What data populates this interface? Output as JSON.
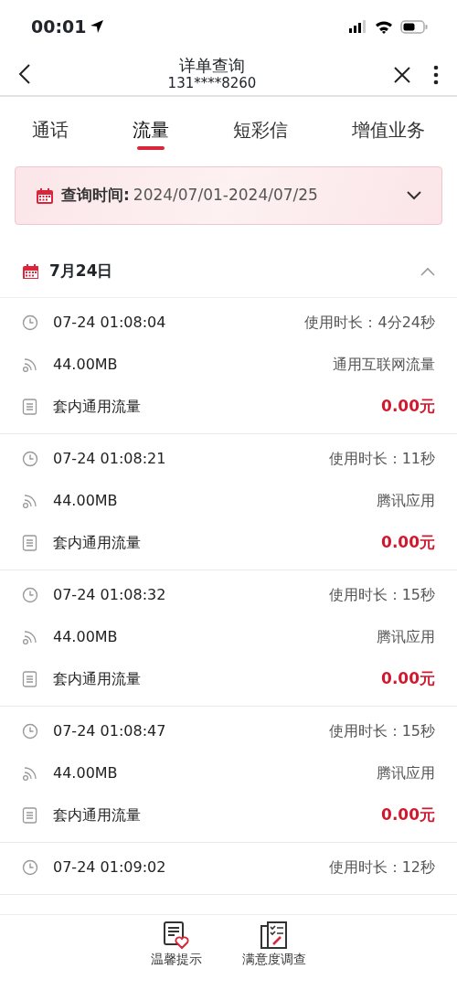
{
  "status_bar": {
    "time": "00:01"
  },
  "header": {
    "title": "详单查询",
    "subtitle": "131****8260"
  },
  "tabs": [
    {
      "label": "通话",
      "selected": false
    },
    {
      "label": "流量",
      "selected": true
    },
    {
      "label": "短彩信",
      "selected": false
    },
    {
      "label": "增值业务",
      "selected": false
    }
  ],
  "query": {
    "label": "查询时间:",
    "value": "2024/07/01-2024/07/25",
    "expanded": false
  },
  "day": {
    "label": "7月24日",
    "expanded": true
  },
  "records": [
    {
      "time": "07-24 01:08:04",
      "duration": "使用时长：4分24秒",
      "volume": "44.00MB",
      "category": "通用互联网流量",
      "package": "套内通用流量",
      "fee": "0.00元"
    },
    {
      "time": "07-24 01:08:21",
      "duration": "使用时长：11秒",
      "volume": "44.00MB",
      "category": "腾讯应用",
      "package": "套内通用流量",
      "fee": "0.00元"
    },
    {
      "time": "07-24 01:08:32",
      "duration": "使用时长：15秒",
      "volume": "44.00MB",
      "category": "腾讯应用",
      "package": "套内通用流量",
      "fee": "0.00元"
    },
    {
      "time": "07-24 01:08:47",
      "duration": "使用时长：15秒",
      "volume": "44.00MB",
      "category": "腾讯应用",
      "package": "套内通用流量",
      "fee": "0.00元"
    },
    {
      "time": "07-24 01:09:02",
      "duration": "使用时长：12秒"
    }
  ],
  "bottom_bar": [
    {
      "kind": "tips",
      "label": "温馨提示"
    },
    {
      "kind": "survey",
      "label": "满意度调查"
    }
  ]
}
